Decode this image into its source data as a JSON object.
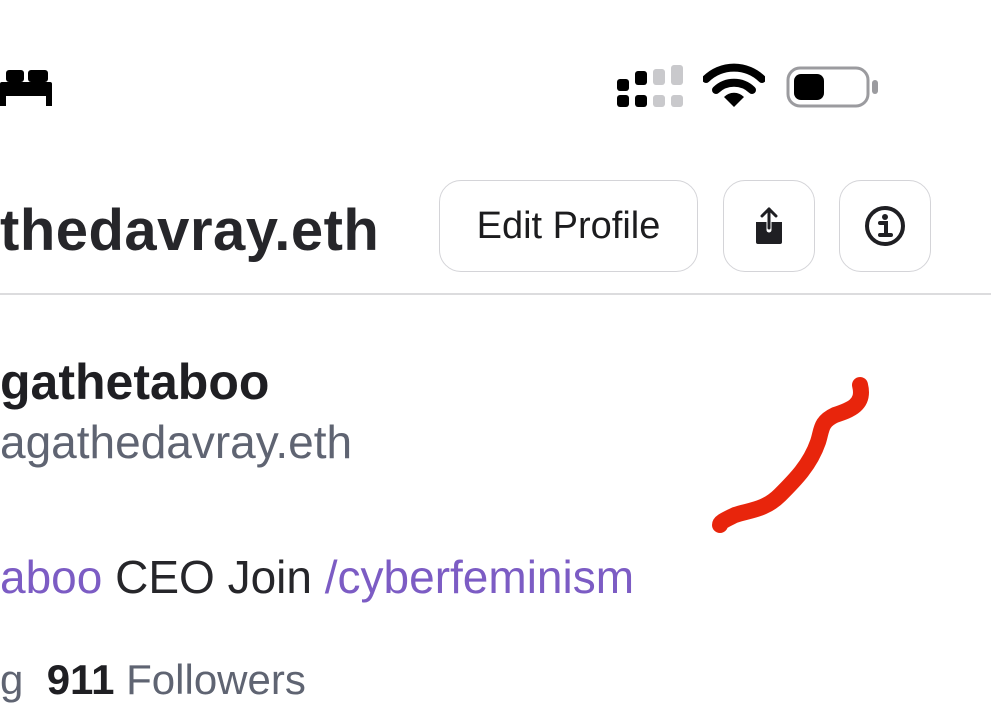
{
  "status_bar": {
    "left_icon": "bed-icon",
    "signal_icon": "cellular-signal-icon",
    "wifi_icon": "wifi-icon",
    "battery_icon": "battery-icon"
  },
  "header": {
    "handle": "thedavray.eth",
    "edit_profile_label": "Edit Profile",
    "share_icon": "share-icon",
    "info_icon": "info-icon"
  },
  "profile": {
    "display_name": "gathetaboo",
    "username": "agathedavray.eth",
    "bio": {
      "link1": "aboo",
      "text1": " CEO  Join ",
      "link2": "/cyberfeminism"
    },
    "stats": {
      "following_suffix": "g",
      "followers_count": "911",
      "followers_label": "Followers"
    }
  },
  "annotation": {
    "color": "#e8250c"
  },
  "colors": {
    "link": "#7c5cc4",
    "muted": "#5f6472"
  }
}
